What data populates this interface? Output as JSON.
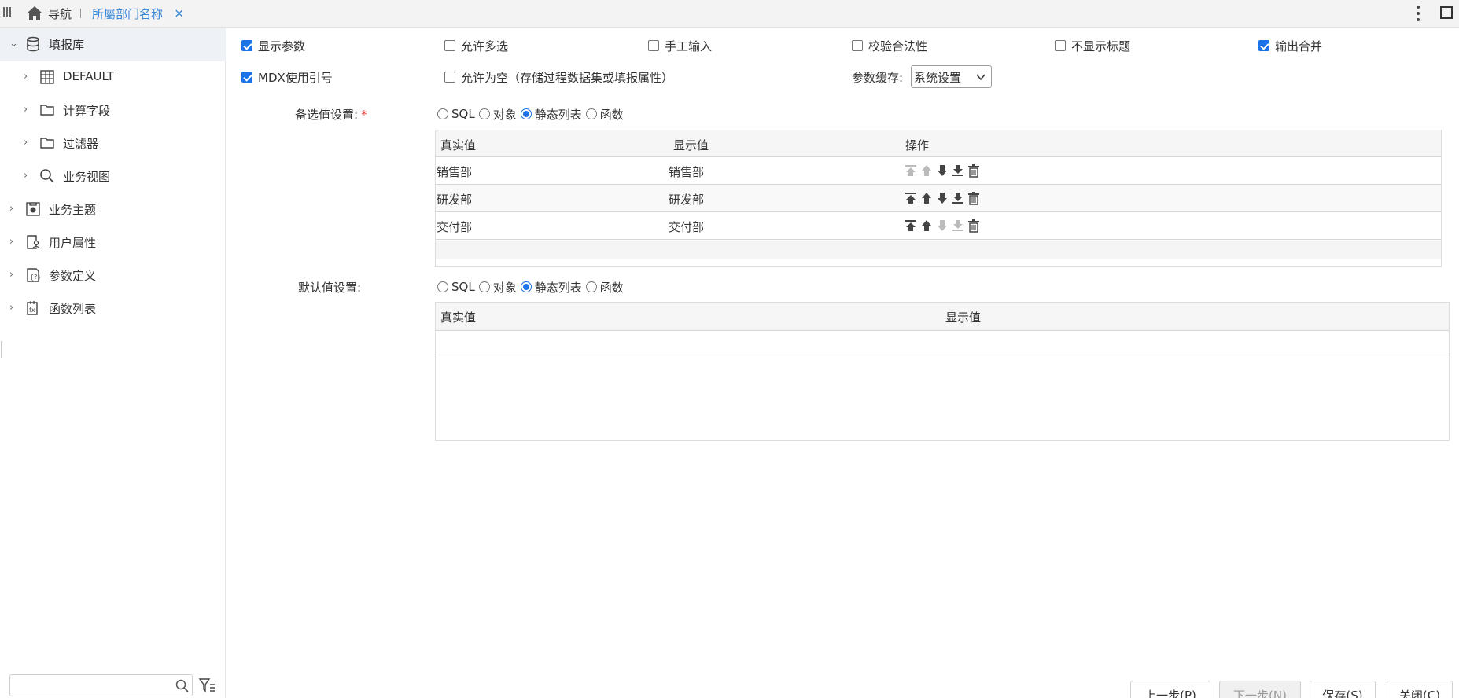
{
  "topbar": {
    "nav_label": "导航",
    "tab_label": "所屬部门名称",
    "tab_close": "×"
  },
  "sidebar": {
    "items": [
      {
        "label": "填报库",
        "icon": "database-icon",
        "expanded": true,
        "selected": true
      },
      {
        "label": "DEFAULT",
        "icon": "table-icon"
      },
      {
        "label": "计算字段",
        "icon": "folder-icon"
      },
      {
        "label": "过滤器",
        "icon": "folder-icon"
      },
      {
        "label": "业务视图",
        "icon": "search-icon"
      },
      {
        "label": "业务主题",
        "icon": "business-theme-icon"
      },
      {
        "label": "用户属性",
        "icon": "user-attribute-icon"
      },
      {
        "label": "参数定义",
        "icon": "parameter-icon"
      },
      {
        "label": "函数列表",
        "icon": "function-list-icon"
      }
    ],
    "search": {
      "value": "",
      "placeholder": ""
    }
  },
  "options": {
    "show_param": {
      "label": "显示参数",
      "checked": true
    },
    "allow_multi": {
      "label": "允许多选",
      "checked": false
    },
    "manual_input": {
      "label": "手工输入",
      "checked": false
    },
    "validate": {
      "label": "校验合法性",
      "checked": false
    },
    "hide_title": {
      "label": "不显示标题",
      "checked": false
    },
    "merge_output": {
      "label": "输出合并",
      "checked": true
    },
    "mdx_quote": {
      "label": "MDX使用引号",
      "checked": true
    },
    "allow_empty": {
      "label": "允许为空（存储过程数据集或填报属性）",
      "checked": false
    },
    "cache_label": "参数缓存:",
    "cache_value": "系统设置"
  },
  "candidate": {
    "label": "备选值设置:",
    "required_mark": "*",
    "radios": [
      {
        "label": "SQL",
        "checked": false
      },
      {
        "label": "对象",
        "checked": false
      },
      {
        "label": "静态列表",
        "checked": true
      },
      {
        "label": "函数",
        "checked": false
      }
    ],
    "columns": [
      "真实值",
      "显示值",
      "操作"
    ],
    "rows": [
      {
        "real": "销售部",
        "display": "销售部",
        "ops": {
          "top": false,
          "up": false,
          "down": true,
          "bottom": true,
          "delete": true
        }
      },
      {
        "real": "研发部",
        "display": "研发部",
        "ops": {
          "top": true,
          "up": true,
          "down": true,
          "bottom": true,
          "delete": true
        }
      },
      {
        "real": "交付部",
        "display": "交付部",
        "ops": {
          "top": true,
          "up": true,
          "down": false,
          "bottom": false,
          "delete": true
        }
      }
    ]
  },
  "default": {
    "label": "默认值设置:",
    "radios": [
      {
        "label": "SQL",
        "checked": false
      },
      {
        "label": "对象",
        "checked": false
      },
      {
        "label": "静态列表",
        "checked": true
      },
      {
        "label": "函数",
        "checked": false
      }
    ],
    "columns": [
      "真实值",
      "显示值"
    ],
    "rows": []
  },
  "buttons": {
    "prev": "上一步(P)",
    "next": "下一步(N)",
    "save": "保存(S)",
    "close": "关闭(C)"
  },
  "colors": {
    "accent": "#1a73e8",
    "tab_active": "#3b8ad9",
    "required": "#e53935"
  }
}
